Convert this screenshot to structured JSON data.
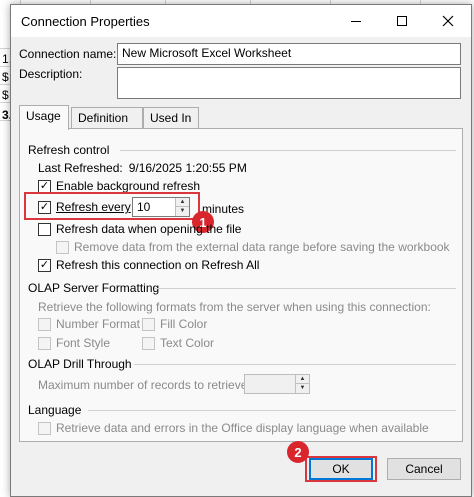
{
  "sheet": {
    "cells": [
      "1,",
      "$",
      "$",
      "3,"
    ]
  },
  "dialog": {
    "title": "Connection Properties",
    "connection_name_label": "Connection name:",
    "connection_name_value": "New Microsoft Excel Worksheet",
    "description_label": "Description:",
    "description_value": "",
    "tabs": [
      {
        "label": "Usage",
        "active": true
      },
      {
        "label": "Definition",
        "active": false
      },
      {
        "label": "Used In",
        "active": false
      }
    ],
    "refresh_control": {
      "heading": "Refresh control",
      "last_refreshed_label": "Last Refreshed:",
      "last_refreshed_value": "9/16/2025  1:20:55 PM",
      "enable_background_refresh": {
        "label": "Enable background refresh",
        "checked": true
      },
      "refresh_every": {
        "label": "Refresh every",
        "checked": true,
        "value": "10",
        "unit": "minutes"
      },
      "refresh_on_open": {
        "label": "Refresh data when opening the file",
        "checked": false
      },
      "remove_data": {
        "label": "Remove data from the external data range before saving the workbook",
        "checked": false,
        "disabled": true
      },
      "refresh_all": {
        "label": "Refresh this connection on Refresh All",
        "checked": true
      }
    },
    "olap_formatting": {
      "heading": "OLAP Server Formatting",
      "desc": "Retrieve the following formats from the server when using this connection:",
      "options": [
        "Number Format",
        "Fill Color",
        "Font Style",
        "Text Color"
      ]
    },
    "olap_drill": {
      "heading": "OLAP Drill Through",
      "max_records_label": "Maximum number of records to retrieve:",
      "max_records_value": ""
    },
    "language": {
      "heading": "Language",
      "option": "Retrieve data and errors in the Office display language when available"
    },
    "buttons": {
      "ok": "OK",
      "cancel": "Cancel"
    },
    "annotations": {
      "badge1": "1",
      "badge2": "2"
    },
    "colors": {
      "highlight": "#d9363e",
      "badge": "#d9262d",
      "default_button_border": "#0078d7"
    }
  }
}
